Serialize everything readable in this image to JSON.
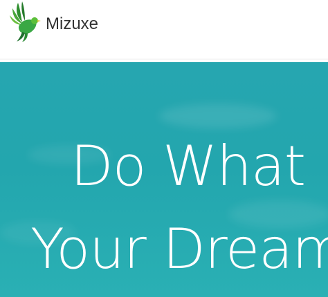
{
  "header": {
    "brand_name": "Mizuxe",
    "logo_icon": "bird-logo-icon"
  },
  "hero": {
    "heading_line1": "Do What",
    "heading_line2": "Your Dream"
  },
  "colors": {
    "hero_background": "#26a6b0",
    "logo_green": "#3a9d3f",
    "brand_text": "#333333"
  }
}
